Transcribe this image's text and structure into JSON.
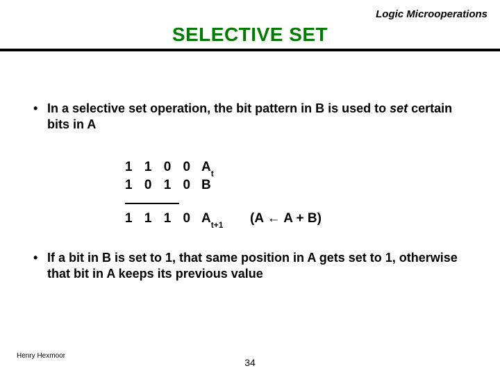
{
  "header": {
    "topic": "Logic Microoperations",
    "title": "SELECTIVE SET"
  },
  "bullets": {
    "first_a": "In a selective set operation, the bit pattern in B is used to ",
    "first_set": "set",
    "first_b": " certain bits in A",
    "second": "If a bit in B is set to 1, that same position in A gets set to 1, otherwise that bit in A keeps its previous value"
  },
  "example": {
    "row1_bits": "1 1 0 0",
    "row1_label_base": "A",
    "row1_label_sub": "t",
    "row2_bits": "1 0 1 0",
    "row2_label": "B",
    "row3_bits": "1 1 1 0",
    "row3_label_base": "A",
    "row3_label_sub": "t+1",
    "expr": "(A ← A + B)"
  },
  "footer": {
    "author": "Henry Hexmoor",
    "page": "34"
  }
}
